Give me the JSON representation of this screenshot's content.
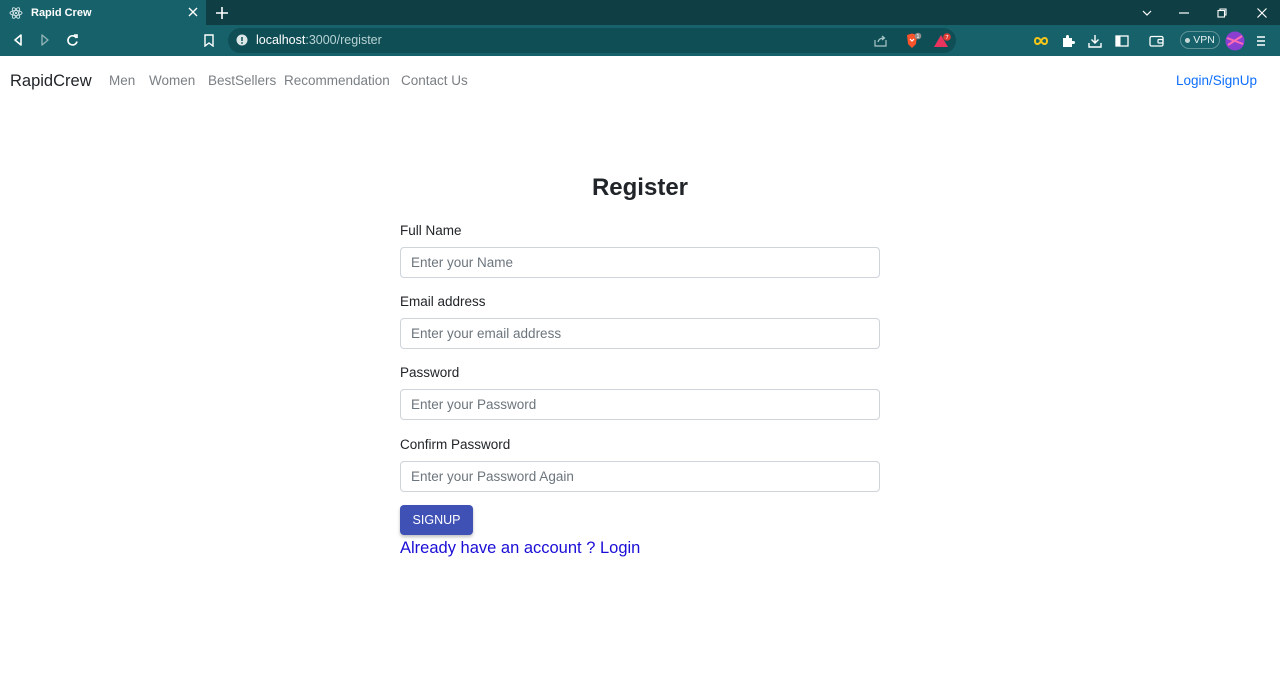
{
  "browser": {
    "tab_title": "Rapid Crew",
    "url_host": "localhost",
    "url_path": ":3000/register",
    "vpn_label": "VPN",
    "brave_badge": "1",
    "rewards_badge": "7",
    "accent": "#17616a"
  },
  "nav": {
    "brand": "RapidCrew",
    "links": [
      "Men",
      "Women",
      "BestSellers",
      "Recommendation",
      "Contact Us"
    ],
    "login": "Login/SignUp"
  },
  "form": {
    "title": "Register",
    "full_name_label": "Full Name",
    "full_name_placeholder": "Enter your Name",
    "email_label": "Email address",
    "email_placeholder": "Enter your email address",
    "password_label": "Password",
    "password_placeholder": "Enter your Password",
    "confirm_label": "Confirm Password",
    "confirm_placeholder": "Enter your Password Again",
    "submit": "SIGNUP",
    "login_prompt": "Already have an account ? Login"
  }
}
